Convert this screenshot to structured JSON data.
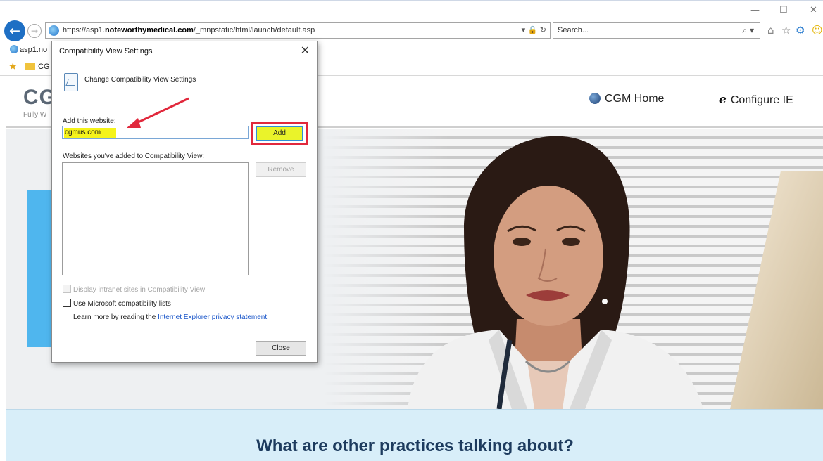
{
  "browser": {
    "url_prefix": "https://asp1.",
    "url_domain": "noteworthymedical.com",
    "url_path": "/_mnpstatic/html/launch/default.asp",
    "address_tools": "▾ 🔒 ↻",
    "search_placeholder": "Search...",
    "search_icon": "⌕ ▾",
    "tab_label": "asp1.no",
    "favorites_label": "CG",
    "win_min": "—",
    "win_max": "☐",
    "win_close": "✕",
    "toolbar_home": "⌂",
    "toolbar_favorites": "☆",
    "toolbar_gear": "⚙",
    "toolbar_smiley": "☺"
  },
  "page": {
    "logo": "CG",
    "logo_tagline": "Fully W",
    "header_links": [
      {
        "label": "CGM Home"
      },
      {
        "label": "Configure IE"
      }
    ],
    "testimonials_title": "What are other practices talking about?"
  },
  "dialog": {
    "title": "Compatibility View Settings",
    "close_glyph": "✕",
    "heading": "Change Compatibility View Settings",
    "add_label": "Add this website:",
    "add_value": "cgmus.com",
    "add_button": "Add",
    "list_label": "Websites you've added to Compatibility View:",
    "remove_button": "Remove",
    "intranet_label": "Display intranet sites in Compatibility View",
    "ms_lists_label": "Use Microsoft compatibility lists",
    "learn_prefix": "Learn more by reading the ",
    "learn_link": "Internet Explorer privacy statement",
    "close_button": "Close"
  },
  "colors": {
    "annotation_red": "#e1283c",
    "highlight_yellow": "#f5f31a",
    "accent_blue": "#1e6fc4"
  }
}
